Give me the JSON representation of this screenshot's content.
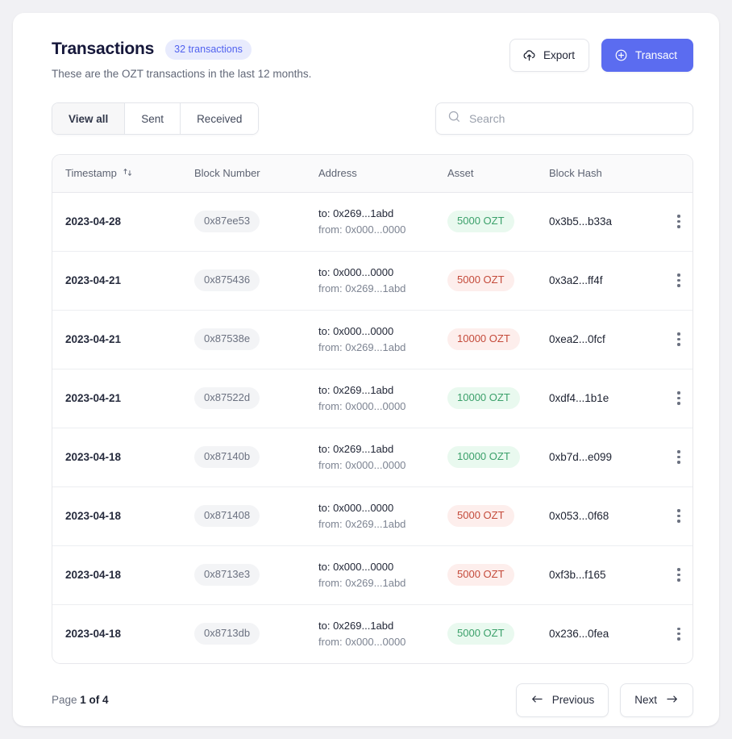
{
  "header": {
    "title": "Transactions",
    "count_badge": "32 transactions",
    "subtitle": "These are the OZT transactions in the last 12 months.",
    "export_label": "Export",
    "transact_label": "Transact",
    "export_icon": "cloud-upload-icon",
    "transact_icon": "plus-circle-icon",
    "accent_color": "#5b6cf0",
    "badge_bg": "#e8ebfd",
    "badge_fg": "#5162ef"
  },
  "toolbar": {
    "tabs": [
      {
        "label": "View all",
        "active": true
      },
      {
        "label": "Sent",
        "active": false
      },
      {
        "label": "Received",
        "active": false
      }
    ],
    "search": {
      "placeholder": "Search",
      "value": "",
      "icon": "search-icon"
    }
  },
  "table": {
    "columns": [
      {
        "label": "Timestamp",
        "sortable": true,
        "sort_icon": "sort-arrows-icon"
      },
      {
        "label": "Block Number",
        "sortable": false
      },
      {
        "label": "Address",
        "sortable": false
      },
      {
        "label": "Asset",
        "sortable": false
      },
      {
        "label": "Block Hash",
        "sortable": false
      },
      {
        "label": "",
        "sortable": false
      }
    ],
    "rows": [
      {
        "timestamp": "2023-04-28",
        "block_number": "0x87ee53",
        "address_to": "to: 0x269...1abd",
        "address_from": "from: 0x000...0000",
        "asset": "5000 OZT",
        "asset_type": "green",
        "block_hash": "0x3b5...b33a",
        "menu_icon": "more-vertical-icon"
      },
      {
        "timestamp": "2023-04-21",
        "block_number": "0x875436",
        "address_to": "to: 0x000...0000",
        "address_from": "from: 0x269...1abd",
        "asset": "5000 OZT",
        "asset_type": "red",
        "block_hash": "0x3a2...ff4f",
        "menu_icon": "more-vertical-icon"
      },
      {
        "timestamp": "2023-04-21",
        "block_number": "0x87538e",
        "address_to": "to: 0x000...0000",
        "address_from": "from: 0x269...1abd",
        "asset": "10000 OZT",
        "asset_type": "red",
        "block_hash": "0xea2...0fcf",
        "menu_icon": "more-vertical-icon"
      },
      {
        "timestamp": "2023-04-21",
        "block_number": "0x87522d",
        "address_to": "to: 0x269...1abd",
        "address_from": "from: 0x000...0000",
        "asset": "10000 OZT",
        "asset_type": "green",
        "block_hash": "0xdf4...1b1e",
        "menu_icon": "more-vertical-icon"
      },
      {
        "timestamp": "2023-04-18",
        "block_number": "0x87140b",
        "address_to": "to: 0x269...1abd",
        "address_from": "from: 0x000...0000",
        "asset": "10000 OZT",
        "asset_type": "green",
        "block_hash": "0xb7d...e099",
        "menu_icon": "more-vertical-icon"
      },
      {
        "timestamp": "2023-04-18",
        "block_number": "0x871408",
        "address_to": "to: 0x000...0000",
        "address_from": "from: 0x269...1abd",
        "asset": "5000 OZT",
        "asset_type": "red",
        "block_hash": "0x053...0f68",
        "menu_icon": "more-vertical-icon"
      },
      {
        "timestamp": "2023-04-18",
        "block_number": "0x8713e3",
        "address_to": "to: 0x000...0000",
        "address_from": "from: 0x269...1abd",
        "asset": "5000 OZT",
        "asset_type": "red",
        "block_hash": "0xf3b...f165",
        "menu_icon": "more-vertical-icon"
      },
      {
        "timestamp": "2023-04-18",
        "block_number": "0x8713db",
        "address_to": "to: 0x269...1abd",
        "address_from": "from: 0x000...0000",
        "asset": "5000 OZT",
        "asset_type": "green",
        "block_hash": "0x236...0fea",
        "menu_icon": "more-vertical-icon"
      }
    ]
  },
  "pagination": {
    "label_prefix": "Page",
    "label_value": "1 of 4",
    "previous_label": "Previous",
    "next_label": "Next",
    "previous_icon": "arrow-left-icon",
    "next_icon": "arrow-right-icon"
  },
  "colors": {
    "page_bg": "#f1f1f4",
    "card_bg": "#ffffff",
    "green_badge_bg": "#e9f9ef",
    "green_badge_fg": "#3ba06a",
    "red_badge_bg": "#fdeeec",
    "red_badge_fg": "#c44a3a"
  }
}
